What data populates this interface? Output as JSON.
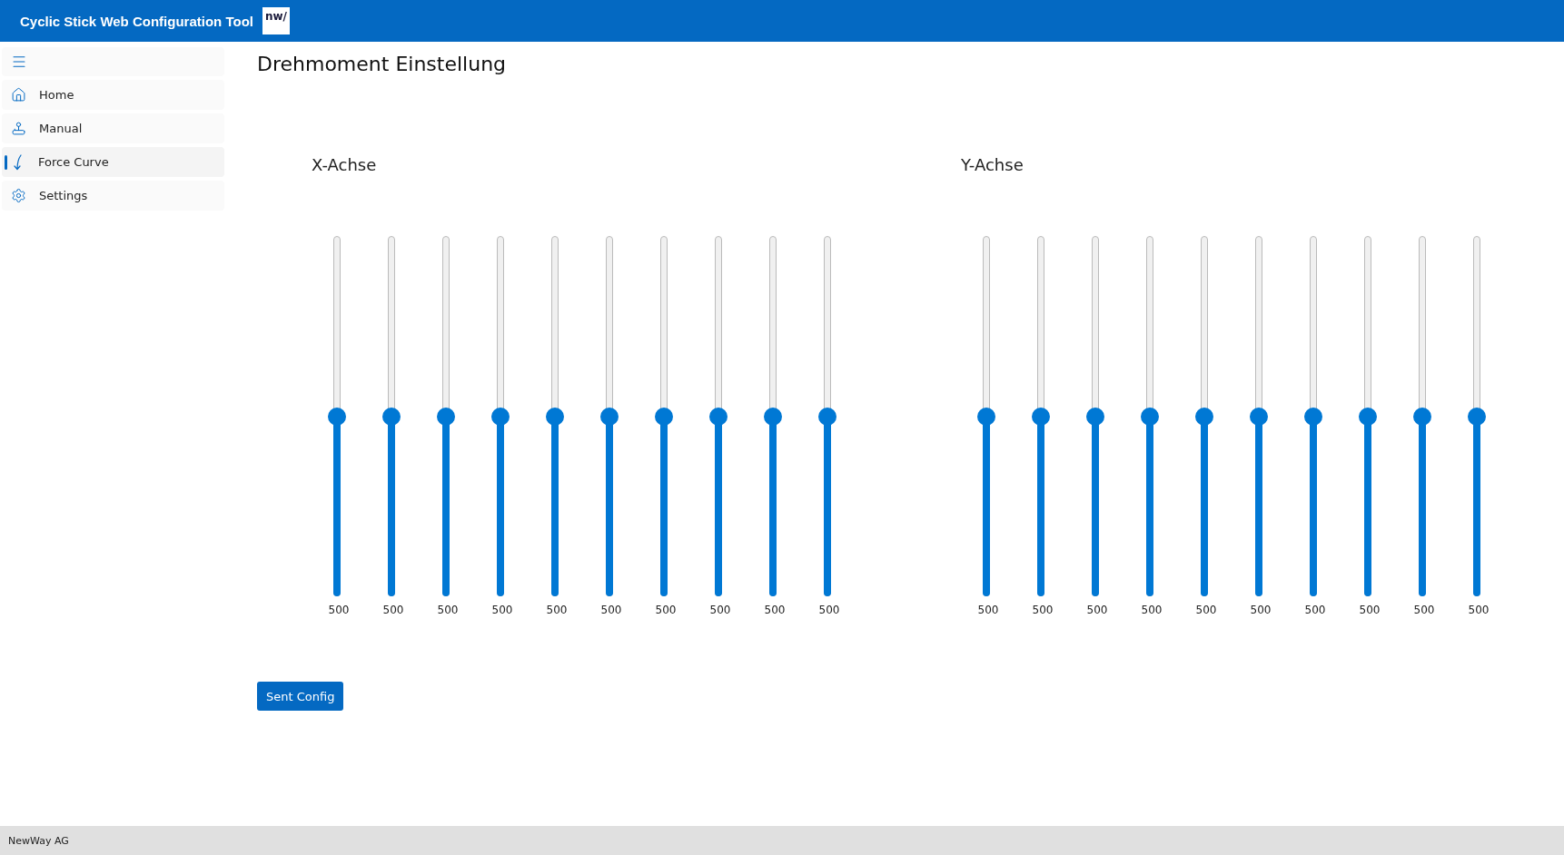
{
  "header": {
    "title": "Cyclic Stick Web Configuration Tool",
    "logo": "nw/"
  },
  "sidebar": {
    "items": [
      {
        "label": "Home",
        "kind": "home",
        "selected": false
      },
      {
        "label": "Manual",
        "kind": "manual",
        "selected": false
      },
      {
        "label": "Force Curve",
        "kind": "curve",
        "selected": true
      },
      {
        "label": "Settings",
        "kind": "settings",
        "selected": false
      }
    ]
  },
  "page": {
    "title": "Drehmoment Einstellung"
  },
  "axes": [
    {
      "title": "X-Achse",
      "sliders": [
        {
          "level": 0.5,
          "reading": "500"
        },
        {
          "level": 0.5,
          "reading": "500"
        },
        {
          "level": 0.5,
          "reading": "500"
        },
        {
          "level": 0.5,
          "reading": "500"
        },
        {
          "level": 0.5,
          "reading": "500"
        },
        {
          "level": 0.5,
          "reading": "500"
        },
        {
          "level": 0.5,
          "reading": "500"
        },
        {
          "level": 0.5,
          "reading": "500"
        },
        {
          "level": 0.5,
          "reading": "500"
        },
        {
          "level": 0.5,
          "reading": "500"
        }
      ]
    },
    {
      "title": "Y-Achse",
      "sliders": [
        {
          "level": 0.5,
          "reading": "500"
        },
        {
          "level": 0.5,
          "reading": "500"
        },
        {
          "level": 0.5,
          "reading": "500"
        },
        {
          "level": 0.5,
          "reading": "500"
        },
        {
          "level": 0.5,
          "reading": "500"
        },
        {
          "level": 0.5,
          "reading": "500"
        },
        {
          "level": 0.5,
          "reading": "500"
        },
        {
          "level": 0.5,
          "reading": "500"
        },
        {
          "level": 0.5,
          "reading": "500"
        },
        {
          "level": 0.5,
          "reading": "500"
        }
      ]
    }
  ],
  "button": {
    "label": "Sent Config"
  },
  "footer": {
    "text": "NewWay AG"
  }
}
